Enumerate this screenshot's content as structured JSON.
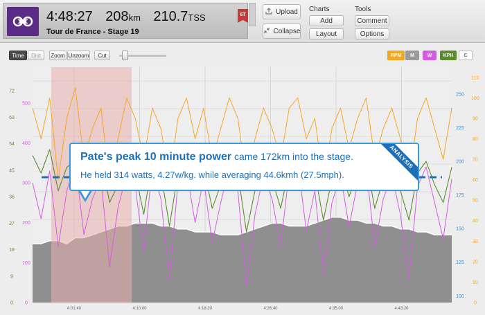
{
  "ride": {
    "duration": "4:48:27",
    "distance_value": "208",
    "distance_unit": "km",
    "tss_value": "210.7",
    "tss_unit": "TSS",
    "name": "Tour de France - Stage 19",
    "badge": "6T",
    "logo_icon": "bike-chain-icon"
  },
  "toolbar": {
    "upload_label": "Upload",
    "collapse_label": "Collapse",
    "charts_group": "Charts",
    "add_label": "Add",
    "layout_label": "Layout",
    "tools_group": "Tools",
    "comment_label": "Comment",
    "options_label": "Options"
  },
  "chart_controls": {
    "time_label": "Time",
    "dist_label": "Dist",
    "zoom_label": "Zoom",
    "unzoom_label": "Unzoom",
    "cut_label": "Cut"
  },
  "legend": [
    {
      "label": "RPM",
      "color": "#f5a623",
      "active": true
    },
    {
      "label": "M",
      "color": "#9a9a9a",
      "active": true
    },
    {
      "label": "W",
      "color": "#d25ee0",
      "active": true
    },
    {
      "label": "KPH",
      "color": "#5d8a2e",
      "active": true
    },
    {
      "label": "C",
      "color": "#ffffff",
      "active": false
    }
  ],
  "callout": {
    "headline": "Pate's peak 10 minute power",
    "line1_rest": " came 172km into the stage.",
    "line2": "He held 314 watts, 4.27w/kg. while averaging 44.6kmh (27.5mph).",
    "ribbon": "ANALYSIS"
  },
  "colors": {
    "cadence": "#f5a623",
    "power": "#d25ee0",
    "speed": "#5d8a2e",
    "elevation": "#8f8f8f",
    "highlight": "#e8b1ad",
    "callout": "#1d6fb8"
  },
  "chart_data": {
    "type": "line",
    "x_ticks": [
      "4:01:40",
      "4:10:00",
      "4:18:20",
      "4:26:40",
      "4:35:00",
      "4:43:20"
    ],
    "axes": {
      "kph": {
        "ticks": [
          0,
          9,
          18,
          27,
          36,
          45,
          54,
          63,
          72
        ]
      },
      "watts": {
        "ticks": [
          0,
          100,
          200,
          300,
          400,
          500
        ]
      },
      "bpm": {
        "ticks": [
          100,
          125,
          150,
          175,
          200,
          225,
          250
        ]
      },
      "rpm": {
        "ticks": [
          0,
          10,
          20,
          30,
          40,
          50,
          60,
          70,
          80,
          90,
          100,
          110
        ]
      }
    },
    "series": [
      {
        "name": "RPM",
        "values": [
          95,
          80,
          100,
          60,
          90,
          105,
          70,
          85,
          95,
          60,
          80,
          100,
          90,
          70,
          95,
          85,
          60,
          90,
          100,
          80,
          95,
          70,
          85,
          100,
          90,
          60,
          80,
          95,
          85,
          70,
          95,
          100,
          80,
          90,
          60,
          85,
          95,
          75,
          90,
          100,
          70,
          85,
          95,
          80,
          60,
          90,
          100,
          85,
          70,
          95
        ]
      },
      {
        "name": "W",
        "values": [
          300,
          210,
          330,
          140,
          280,
          350,
          170,
          260,
          310,
          90,
          240,
          320,
          290,
          130,
          340,
          260,
          60,
          300,
          330,
          200,
          310,
          150,
          250,
          340,
          280,
          40,
          220,
          320,
          260,
          140,
          330,
          350,
          180,
          280,
          70,
          250,
          320,
          190,
          300,
          340,
          140,
          260,
          320,
          220,
          60,
          290,
          340,
          250,
          160,
          310
        ]
      },
      {
        "name": "KPH",
        "values": [
          50,
          44,
          52,
          38,
          46,
          48,
          36,
          42,
          50,
          34,
          40,
          46,
          44,
          30,
          48,
          44,
          26,
          44,
          50,
          38,
          46,
          32,
          40,
          48,
          44,
          24,
          38,
          46,
          42,
          32,
          46,
          48,
          38,
          44,
          28,
          42,
          46,
          36,
          44,
          48,
          32,
          42,
          46,
          38,
          28,
          44,
          48,
          40,
          34,
          46
        ]
      },
      {
        "name": "M",
        "values": [
          20,
          20,
          21,
          21,
          20,
          22,
          22,
          23,
          24,
          25,
          26,
          26,
          27,
          27,
          27,
          26,
          26,
          25,
          25,
          24,
          24,
          24,
          23,
          23,
          23,
          24,
          25,
          26,
          27,
          27,
          26,
          26,
          26,
          27,
          28,
          29,
          29,
          28,
          28,
          27,
          27,
          26,
          26,
          25,
          25,
          24,
          24,
          23,
          23,
          23
        ]
      }
    ],
    "highlight_range": {
      "start": "4:01:40",
      "end": "4:10:00"
    },
    "reference_line": {
      "axis": "watts",
      "value": 314
    },
    "legend_position": "top-right",
    "grid": true
  }
}
